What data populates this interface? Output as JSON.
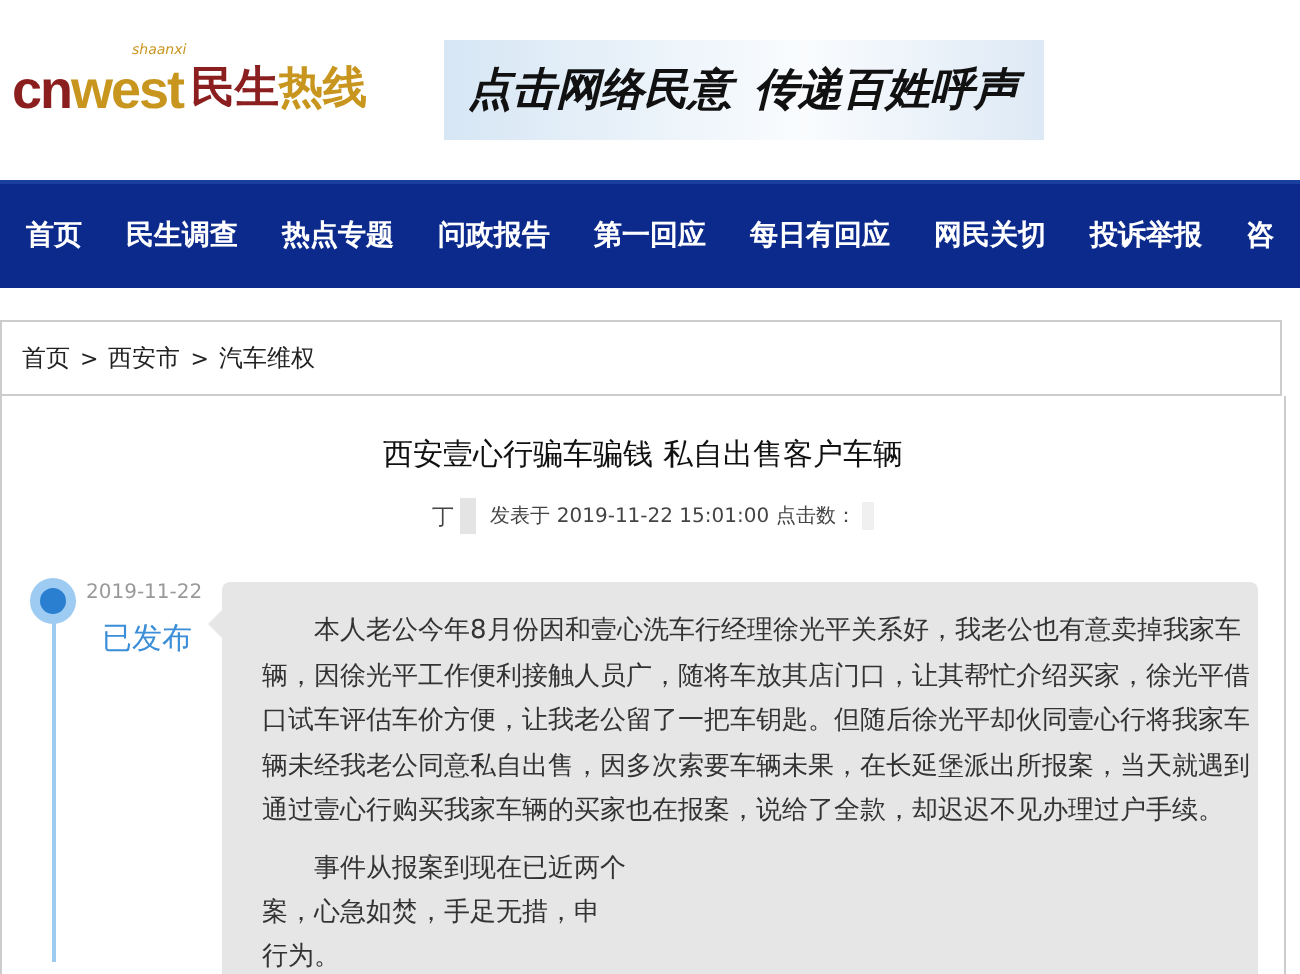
{
  "header": {
    "logo": {
      "tag": "shaanxi",
      "brand_a": "cn",
      "brand_b": "west",
      "name_a": "民生",
      "name_b": "热线"
    },
    "banner": {
      "text": "点击网络民意  传递百姓呼声"
    }
  },
  "nav": [
    {
      "label": "首页"
    },
    {
      "label": "民生调查"
    },
    {
      "label": "热点专题"
    },
    {
      "label": "问政报告"
    },
    {
      "label": "第一回应"
    },
    {
      "label": "每日有回应"
    },
    {
      "label": "网民关切"
    },
    {
      "label": "投诉举报"
    },
    {
      "label": "咨"
    }
  ],
  "breadcrumb": {
    "separator": ">",
    "items": [
      {
        "label": "首页"
      },
      {
        "label": "西安市"
      },
      {
        "label": "汽车维权"
      }
    ]
  },
  "article": {
    "title": "西安壹心行骗车骗钱 私自出售客户车辆",
    "author": "丁",
    "meta": "发表于 2019-11-22 15:01:00 点击数：",
    "timeline": {
      "date": "2019-11-22",
      "status": "已发布"
    },
    "paragraphs": [
      {
        "kind": "full",
        "text": "本人老公今年8月份因和壹心洗车行经理徐光平关系好，我老公也有意卖掉我家车辆，因徐光平工作便利接触人员广，随将车放其店门口，让其帮忙介绍买家，徐光平借口试车评估车价方便，让我老公留了一把车钥匙。但随后徐光平却伙同壹心行将我家车辆未经我老公同意私自出售，因多次索要车辆未果，在长延堡派出所报案，当天就遇到通过壹心行购买我家车辆的买家也在报案，说给了全款，却迟迟不见办理过户手续。"
      },
      {
        "kind": "lines",
        "lines": [
          "事件从报案到现在已近两个",
          "案，心急如焚，手足无措，申",
          "行为。"
        ]
      }
    ]
  }
}
